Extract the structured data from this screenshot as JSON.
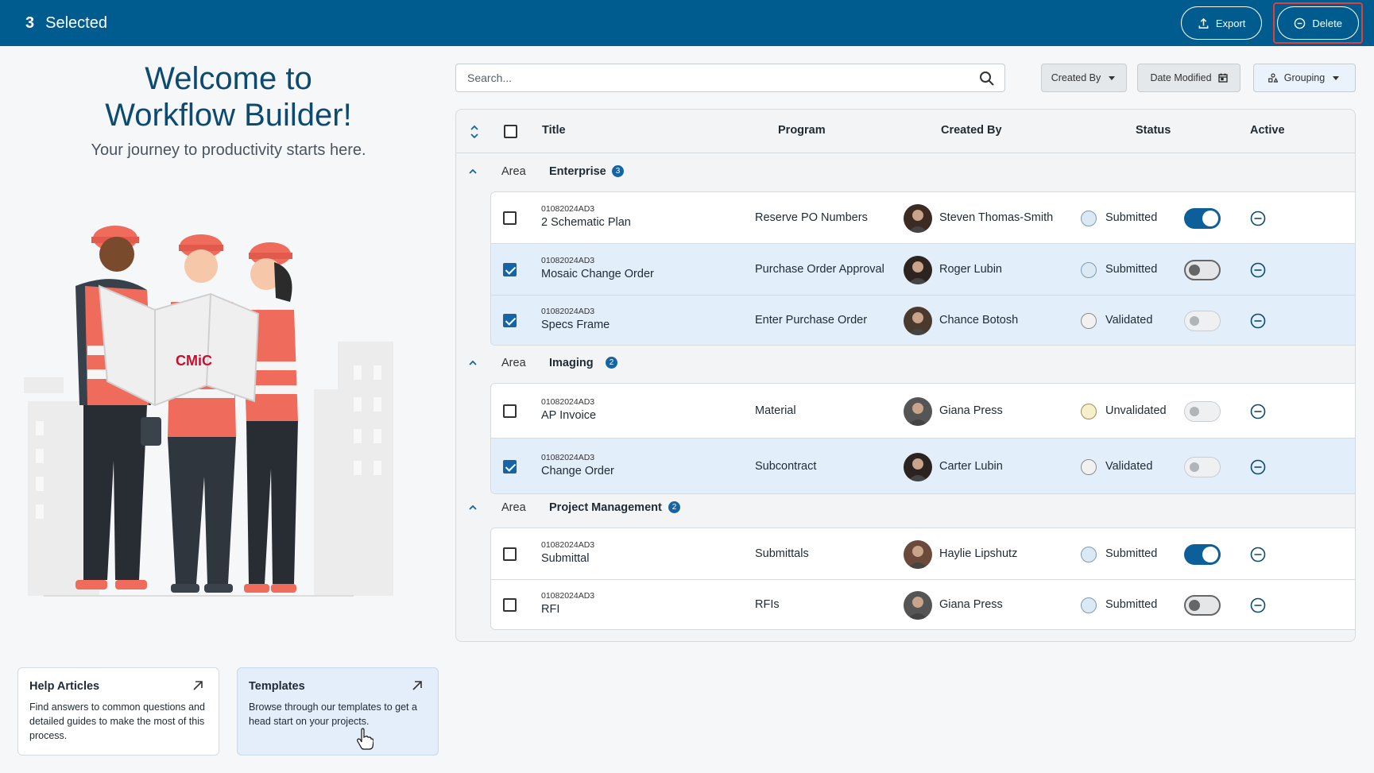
{
  "topbar": {
    "selected_count": "3",
    "selected_label": "Selected",
    "export_label": "Export",
    "delete_label": "Delete",
    "bg_color": "#005b8e"
  },
  "welcome": {
    "title_line1": "Welcome to",
    "title_line2": "Workflow Builder!",
    "subtitle": "Your journey to productivity starts here.",
    "logo_text": "CMiC"
  },
  "cards": {
    "help": {
      "title": "Help Articles",
      "body": "Find answers to common questions and detailed guides to make the most of this process."
    },
    "templates": {
      "title": "Templates",
      "body": "Browse through our templates to get a head start on your projects."
    }
  },
  "filters": {
    "search_placeholder": "Search...",
    "created_by": "Created By",
    "date_modified": "Date Modified",
    "grouping": "Grouping"
  },
  "table": {
    "columns": {
      "title": "Title",
      "program": "Program",
      "created_by": "Created By",
      "status": "Status",
      "active": "Active"
    },
    "area_label": "Area",
    "groups": [
      {
        "name": "Enterprise",
        "count": "3",
        "rows": [
          {
            "code": "01082024AD3",
            "title": "2 Schematic Plan",
            "program": "Reserve PO Numbers",
            "creator": "Steven Thomas-Smith",
            "status": "Submitted",
            "checked": false,
            "active": "on"
          },
          {
            "code": "01082024AD3",
            "title": "Mosaic Change Order",
            "program": "Purchase Order Approval",
            "creator": "Roger Lubin",
            "status": "Submitted",
            "checked": true,
            "active": "off"
          },
          {
            "code": "01082024AD3",
            "title": "Specs Frame",
            "program": "Enter Purchase Order",
            "creator": "Chance Botosh",
            "status": "Validated",
            "checked": true,
            "active": "disabled"
          }
        ]
      },
      {
        "name": "Imaging",
        "count": "2",
        "rows": [
          {
            "code": "01082024AD3",
            "title": "AP Invoice",
            "program": "Material",
            "creator": "Giana Press",
            "status": "Unvalidated",
            "checked": false,
            "active": "disabled"
          },
          {
            "code": "01082024AD3",
            "title": "Change Order",
            "program": "Subcontract",
            "creator": "Carter Lubin",
            "status": "Validated",
            "checked": true,
            "active": "disabled"
          }
        ]
      },
      {
        "name": "Project Management",
        "count": "2",
        "rows": [
          {
            "code": "01082024AD3",
            "title": "Submittal",
            "program": "Submittals",
            "creator": "Haylie Lipshutz",
            "status": "Submitted",
            "checked": false,
            "active": "on"
          },
          {
            "code": "01082024AD3",
            "title": "RFI",
            "program": "RFIs",
            "creator": "Giana Press",
            "status": "Submitted",
            "checked": false,
            "active": "off"
          }
        ]
      }
    ]
  },
  "status_colors": {
    "Submitted": {
      "fill": "#dbe9f5",
      "border": "#7e9bb3"
    },
    "Validated": {
      "fill": "#f1f1f1",
      "border": "#8c8c8c"
    },
    "Unvalidated": {
      "fill": "#f7efc9",
      "border": "#9a8f60"
    }
  }
}
